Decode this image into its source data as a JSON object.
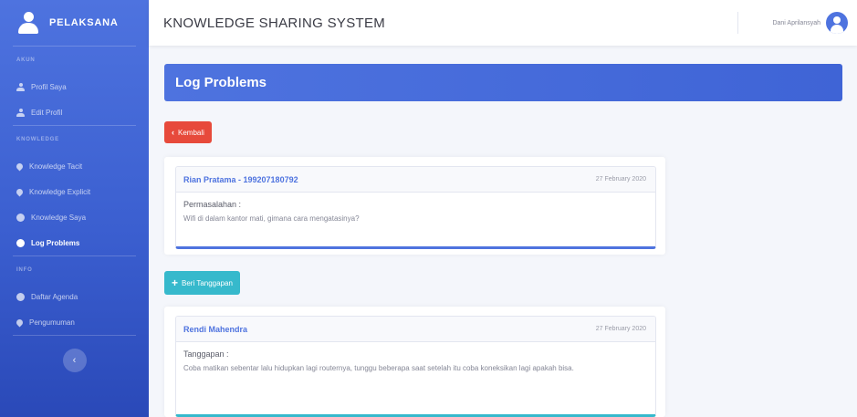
{
  "sidebar": {
    "brand": "PELAKSANA",
    "section_akun": "AKUN",
    "section_knowledge": "KNOWLEDGE",
    "section_info": "INFO",
    "items": [
      {
        "label": "Profil Saya",
        "icon": "user-icon"
      },
      {
        "label": "Edit Profil",
        "icon": "user-edit-icon"
      },
      {
        "label": "Knowledge Tacit",
        "icon": "lightbulb-icon"
      },
      {
        "label": "Knowledge Explicit",
        "icon": "lightbulb-outline-icon"
      },
      {
        "label": "Knowledge Saya",
        "icon": "circle-icon"
      },
      {
        "label": "Log Problems",
        "icon": "info-circle-icon",
        "active": true
      },
      {
        "label": "Daftar Agenda",
        "icon": "calendar-icon"
      },
      {
        "label": "Pengumuman",
        "icon": "bullhorn-icon"
      }
    ],
    "toggle_label": "‹"
  },
  "topbar": {
    "title": "KNOWLEDGE SHARING SYSTEM",
    "user_name": "Dani Aprilansyah"
  },
  "page": {
    "title": "Log Problems",
    "back_button": "Kembali",
    "reply_button": "Beri Tanggapan"
  },
  "problem": {
    "author": "Rian Pratama - 199207180792",
    "date": "27 February 2020",
    "label": "Permasalahan :",
    "text": "Wifi di dalam kantor mati, gimana cara mengatasinya?"
  },
  "response": {
    "author": "Rendi Mahendra",
    "date": "27 February 2020",
    "label": "Tanggapan :",
    "text": "Coba matikan sebentar lalu hidupkan lagi routernya, tunggu beberapa saat setelah itu coba koneksikan lagi apakah bisa."
  },
  "colors": {
    "primary": "#4e73df",
    "danger": "#e74a3b",
    "info": "#36b9cc"
  }
}
